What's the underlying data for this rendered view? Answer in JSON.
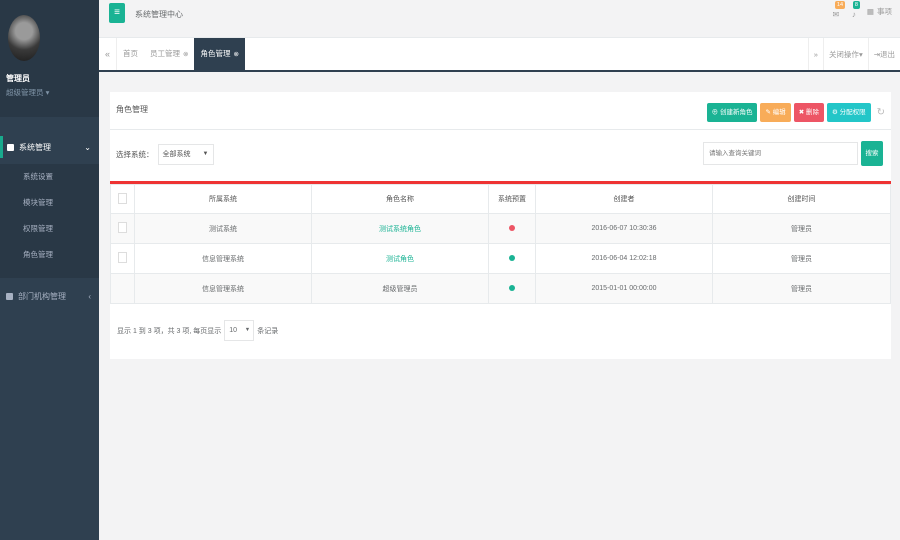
{
  "sidebar": {
    "user_name": "管理员",
    "user_role": "超级管理员",
    "groups": [
      {
        "label": "系统管理",
        "caret": "⌄"
      },
      {
        "label": "部门机构管理",
        "caret": "‹"
      }
    ],
    "items": [
      {
        "label": "系统设置"
      },
      {
        "label": "模块管理"
      },
      {
        "label": "权限管理"
      },
      {
        "label": "角色管理"
      }
    ]
  },
  "topbar": {
    "menu_icon": "≡",
    "title": "系统管理中心",
    "mail_count": "14",
    "bell_count": "8",
    "theme_label": "事项"
  },
  "tabbar": {
    "tabs": [
      {
        "label": "首页",
        "close": ""
      },
      {
        "label": "员工管理",
        "close": "⊗"
      },
      {
        "label": "角色管理",
        "close": "⊗"
      }
    ],
    "close_ops": "关闭操作",
    "logout": "退出"
  },
  "panel": {
    "title": "角色管理",
    "buttons": {
      "create": "创建新角色",
      "edit": "编辑",
      "delete": "删除",
      "assign": "分配权限"
    },
    "filter_label": "选择系统：",
    "filter_value": "全部系统",
    "search_placeholder": "请输入查询关键词",
    "search_button": "搜索"
  },
  "table": {
    "columns": [
      "所属系统",
      "角色名称",
      "系统预置",
      "创建者",
      "创建时间"
    ],
    "rows": [
      {
        "system": "测试系统",
        "role": "测试系统角色",
        "preset_color": "#ed5565",
        "creator": "2016-06-07 10:30:36",
        "time": "管理员",
        "has_checkbox": true
      },
      {
        "system": "信息管理系统",
        "role": "测试角色",
        "preset_color": "#1ab394",
        "creator": "2016-06-04 12:02:18",
        "time": "管理员",
        "has_checkbox": true
      },
      {
        "system": "信息管理系统",
        "role": "超级管理员",
        "preset_color": "#1ab394",
        "creator": "2015-01-01 00:00:00",
        "time": "管理员",
        "has_checkbox": false
      }
    ]
  },
  "pager": {
    "summary": "显示 1 到 3 项，共 3 项, 每页显示",
    "page_size": "10",
    "suffix": "条记录"
  }
}
